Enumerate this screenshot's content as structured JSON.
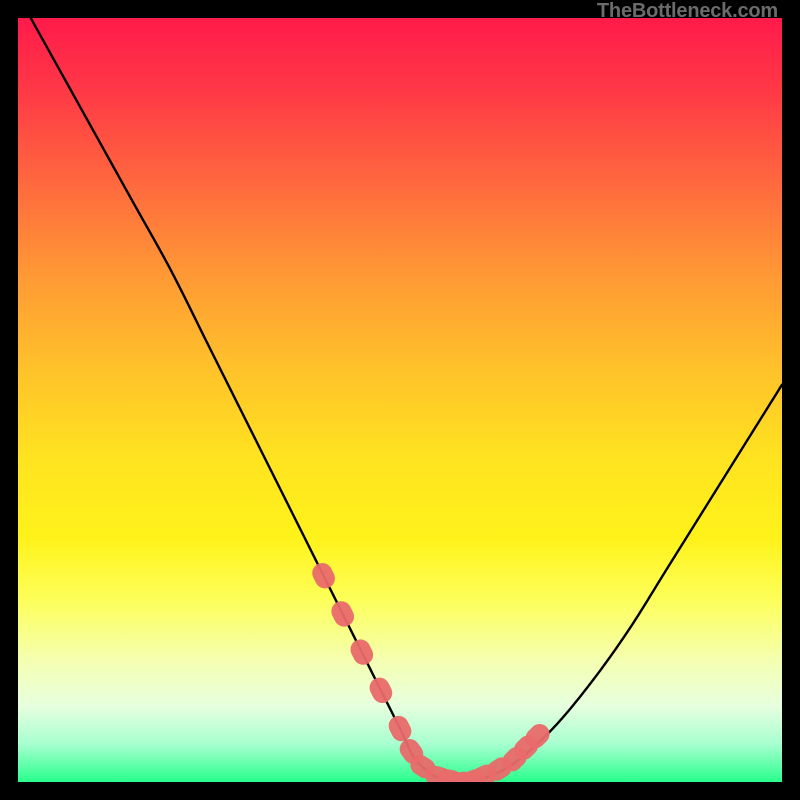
{
  "watermark": "TheBottleneck.com",
  "chart_data": {
    "type": "line",
    "title": "",
    "xlabel": "",
    "ylabel": "",
    "xlim": [
      0,
      100
    ],
    "ylim": [
      0,
      100
    ],
    "grid": false,
    "legend": false,
    "series": [
      {
        "name": "curve",
        "x": [
          0,
          5,
          10,
          15,
          20,
          25,
          30,
          35,
          40,
          45,
          50,
          52,
          55,
          58,
          61,
          65,
          70,
          75,
          80,
          85,
          90,
          95,
          100
        ],
        "y": [
          103,
          94,
          85,
          76,
          67,
          57,
          47,
          37,
          27,
          17,
          7,
          3,
          0.5,
          0,
          0.5,
          2.5,
          7,
          13,
          20,
          28,
          36,
          44,
          52
        ]
      }
    ],
    "marker_band": {
      "name": "highlighted-points",
      "color": "#e96a6a",
      "x_range": [
        40,
        68
      ],
      "points": [
        {
          "x": 40,
          "y": 27
        },
        {
          "x": 42.5,
          "y": 22
        },
        {
          "x": 45,
          "y": 17
        },
        {
          "x": 47.5,
          "y": 12
        },
        {
          "x": 50,
          "y": 7
        },
        {
          "x": 51.5,
          "y": 4
        },
        {
          "x": 53,
          "y": 2
        },
        {
          "x": 55,
          "y": 0.7
        },
        {
          "x": 56.5,
          "y": 0.3
        },
        {
          "x": 58,
          "y": 0
        },
        {
          "x": 59.5,
          "y": 0.2
        },
        {
          "x": 61,
          "y": 0.8
        },
        {
          "x": 63,
          "y": 1.7
        },
        {
          "x": 65,
          "y": 3
        },
        {
          "x": 66.5,
          "y": 4.5
        },
        {
          "x": 68,
          "y": 6
        }
      ]
    }
  }
}
